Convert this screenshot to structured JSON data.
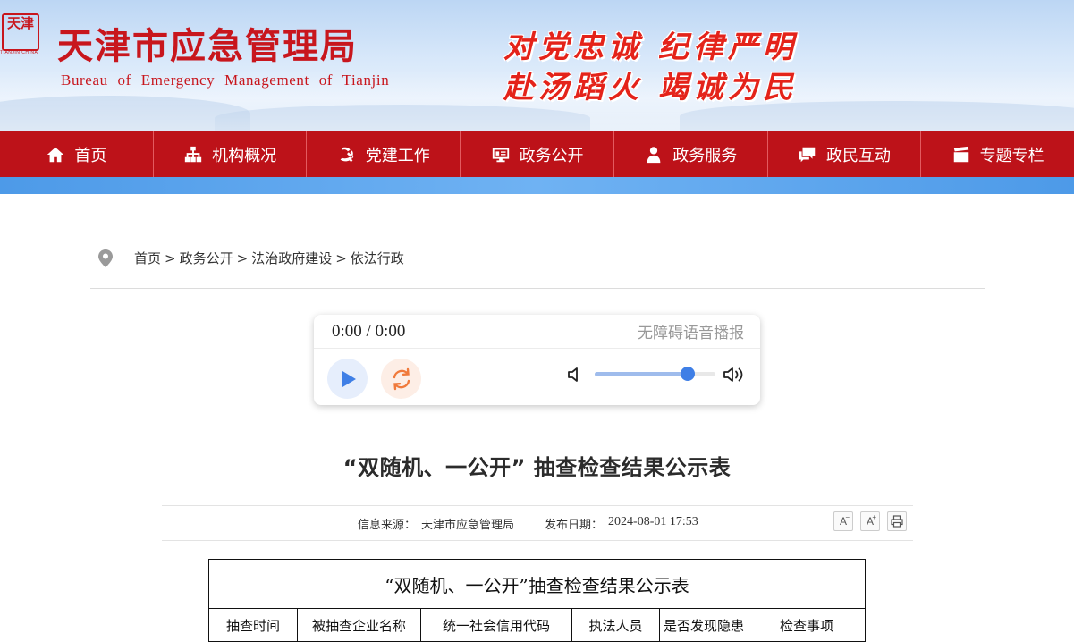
{
  "header": {
    "logo_text": "天津",
    "logo_caption": "TIANJIN CHINA",
    "title": "天津市应急管理局",
    "subtitle": "Bureau  of  Emergency  Management  of  Tianjin",
    "slogan_line1": "对党忠诚  纪律严明",
    "slogan_line2": "赴汤蹈火  竭诚为民"
  },
  "nav": {
    "items": [
      {
        "label": "首页",
        "icon": "home-icon"
      },
      {
        "label": "机构概况",
        "icon": "org-chart-icon"
      },
      {
        "label": "党建工作",
        "icon": "party-emblem-icon"
      },
      {
        "label": "政务公开",
        "icon": "monitor-icon"
      },
      {
        "label": "政务服务",
        "icon": "user-icon"
      },
      {
        "label": "政民互动",
        "icon": "chat-icon"
      },
      {
        "label": "专题专栏",
        "icon": "clapper-icon"
      }
    ]
  },
  "breadcrumb": {
    "icon": "location-pin-icon",
    "items": [
      "首页",
      "政务公开",
      "法治政府建设",
      "依法行政"
    ],
    "separator": ">"
  },
  "player": {
    "time": "0:00 / 0:00",
    "label": "无障碍语音播报",
    "volume": 0.77
  },
  "article": {
    "title": "“双随机、一公开” 抽查检查结果公示表",
    "source_label": "信息来源：",
    "source": "天津市应急管理局",
    "date_label": "发布日期：",
    "date": "2024-08-01 17:53",
    "tools": {
      "decrease": "A",
      "increase": "A"
    }
  },
  "table": {
    "caption": "“双随机、一公开”抽查检查结果公示表",
    "headers": [
      "抽查时间",
      "被抽查企业名称",
      "统一社会信用代码",
      "执法人员",
      "是否发现隐患",
      "检查事项"
    ]
  }
}
